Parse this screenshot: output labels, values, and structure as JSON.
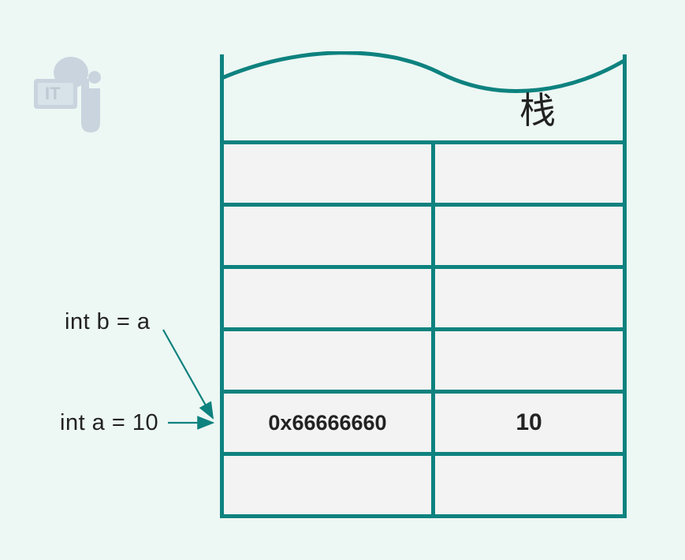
{
  "diagram": {
    "title": "栈",
    "logo_label": "IT",
    "labels": {
      "b": "int b = a",
      "a": "int a = 10"
    },
    "rows": [
      {
        "address": "",
        "value": ""
      },
      {
        "address": "",
        "value": ""
      },
      {
        "address": "",
        "value": ""
      },
      {
        "address": "",
        "value": ""
      },
      {
        "address": "0x66666660",
        "value": "10"
      },
      {
        "address": "",
        "value": ""
      }
    ]
  }
}
